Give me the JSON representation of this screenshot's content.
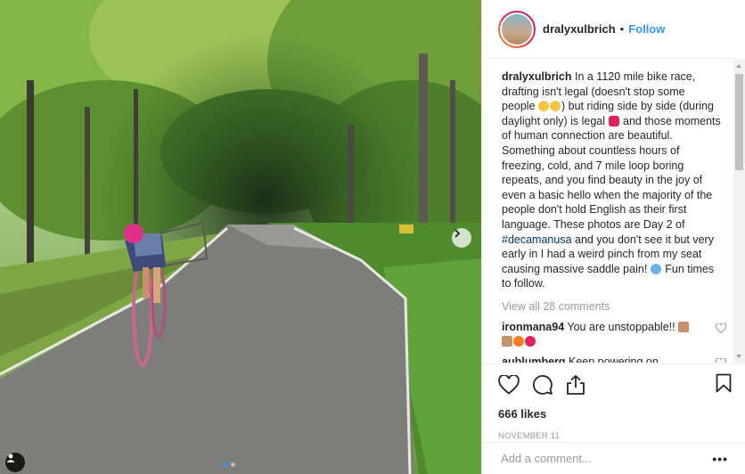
{
  "post": {
    "username": "dralyxulbrich",
    "separator": "•",
    "follow_label": "Follow",
    "caption": {
      "username": "dralyxulbrich",
      "part1": " In a 1120 mile bike race, drafting isn't legal (doesn't stop some people ",
      "part2": ") but riding side by side (during daylight only) is legal ",
      "part3": " and those moments of human connection are beautiful. Something about countless hours of freezing, cold, and 7 mile loop boring repeats, and you find beauty in the joy of even a basic hello when the majority of the people don't hold English as their first language. These photos are Day 2 of ",
      "hashtag": "#decamanusa",
      "part4": " and you don't see it but very early in I had a weird pinch from my seat causing massive saddle pain! ",
      "part5": " Fun times to follow."
    },
    "view_all_label": "View all 28 comments",
    "comments": [
      {
        "username": "ironmana94",
        "text": " You are unstoppable!! "
      },
      {
        "username": "aublumberg",
        "text": " Keep powering on."
      }
    ],
    "likes": "666 likes",
    "date": "NOVEMBER 11",
    "add_comment_placeholder": "Add a comment...",
    "more_label": "•••"
  },
  "icons": {
    "like": "heart-icon",
    "comment": "comment-bubble-icon",
    "share": "share-icon",
    "save": "bookmark-icon",
    "next": "chevron-right-icon",
    "tag": "user-tag-icon"
  },
  "colors": {
    "accent": "#3897f0",
    "hashtag": "#003569",
    "muted": "#999999",
    "text": "#262626"
  }
}
